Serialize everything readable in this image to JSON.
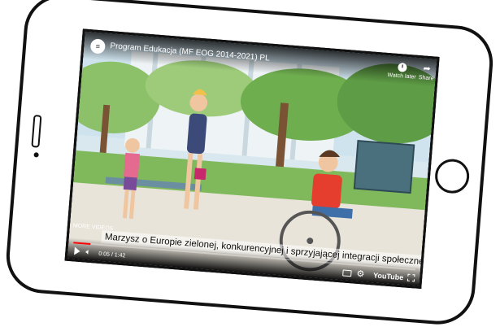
{
  "video": {
    "title": "Program Edukacja (MF EOG 2014-2021) PL",
    "subtitle": "Marzysz o Europie zielonej, konkurencyjnej i sprzyjającej integracji społecznej?",
    "more_videos": "MORE VIDEOS",
    "time": "0:05 / 1:42",
    "progress": 0.05
  },
  "actions": {
    "watch_later": "Watch later",
    "share": "Share"
  },
  "brand": {
    "youtube": "YouTube"
  },
  "colors": {
    "progress": "#ff0000",
    "scene_sky": "#cfe3ee",
    "foliage": "#6fae4f"
  }
}
